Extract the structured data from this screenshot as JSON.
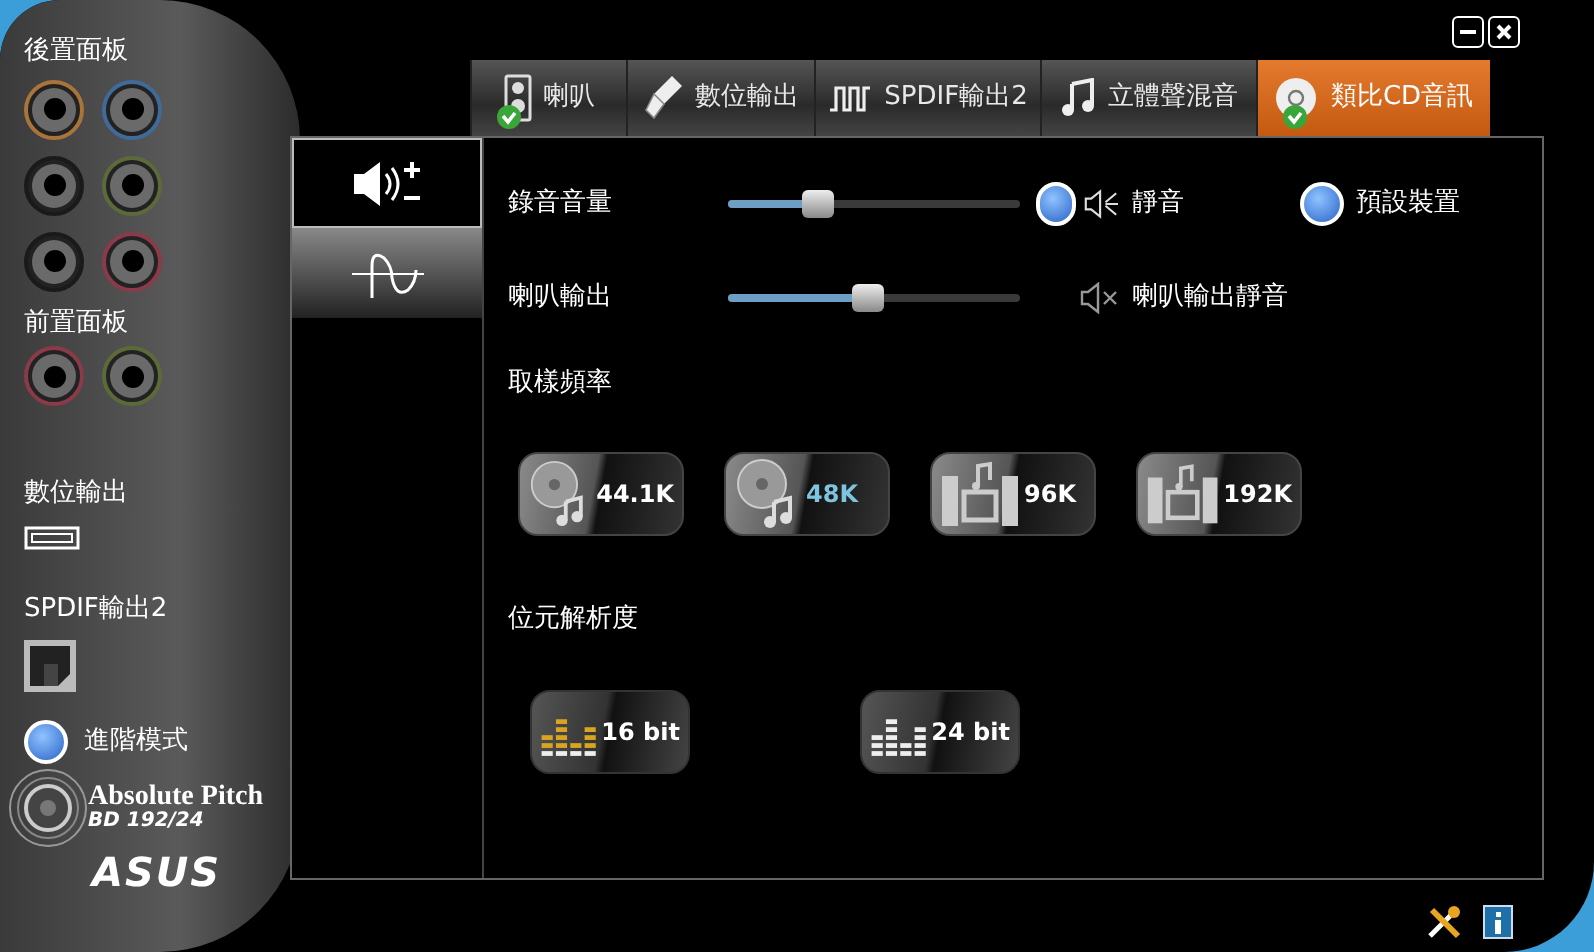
{
  "sidebar": {
    "rear_panel": {
      "label": "後置面板",
      "jacks": [
        {
          "color": "#a8743a"
        },
        {
          "color": "#3f6a9a"
        },
        {
          "color": "#1a1a1a"
        },
        {
          "color": "#5c6a3a"
        },
        {
          "color": "#1a1a1a"
        },
        {
          "color": "#8a3a48"
        }
      ]
    },
    "front_panel": {
      "label": "前置面板",
      "jacks": [
        {
          "color": "#8a3a48"
        },
        {
          "color": "#5c6a3a"
        }
      ]
    },
    "digital_output": {
      "label": "數位輸出"
    },
    "spdif_output": {
      "label": "SPDIF輸出2"
    },
    "advanced_mode": {
      "label": "進階模式",
      "on": true
    },
    "logo": {
      "title": "Absolute Pitch",
      "subtitle": "BD 192/24",
      "brand": "ASUS"
    }
  },
  "tabs": [
    {
      "label": "喇叭",
      "kind": "speaker",
      "default": true,
      "selected": false
    },
    {
      "label": "數位輸出",
      "kind": "usb",
      "default": false,
      "selected": false
    },
    {
      "label": "SPDIF輸出2",
      "kind": "pulse",
      "default": false,
      "selected": false
    },
    {
      "label": "立體聲混音",
      "kind": "note",
      "default": false,
      "selected": false
    },
    {
      "label": "類比CD音訊",
      "kind": "disc",
      "default": true,
      "selected": true
    }
  ],
  "side_tabs": [
    {
      "kind": "volume",
      "selected": true
    },
    {
      "kind": "wave",
      "selected": false
    }
  ],
  "volume_rows": [
    {
      "label": "錄音音量",
      "level": 0.31,
      "indicator": true,
      "muted": false,
      "mute_label": "靜音"
    },
    {
      "label": "喇叭輸出",
      "level": 0.48,
      "indicator": false,
      "muted": true,
      "mute_label": "喇叭輸出靜音"
    }
  ],
  "default_device": {
    "label": "預設裝置",
    "on": true
  },
  "sample_rate": {
    "label": "取樣頻率",
    "options": [
      {
        "label": "44.1K",
        "kind": "disc",
        "selected": false
      },
      {
        "label": "48K",
        "kind": "disc",
        "selected": true
      },
      {
        "label": "96K",
        "kind": "speakers",
        "selected": false
      },
      {
        "label": "192K",
        "kind": "speakers",
        "selected": false
      }
    ]
  },
  "bit_depth": {
    "label": "位元解析度",
    "options": [
      {
        "label": "16 bit",
        "selected": true
      },
      {
        "label": "24 bit",
        "selected": false
      }
    ]
  }
}
